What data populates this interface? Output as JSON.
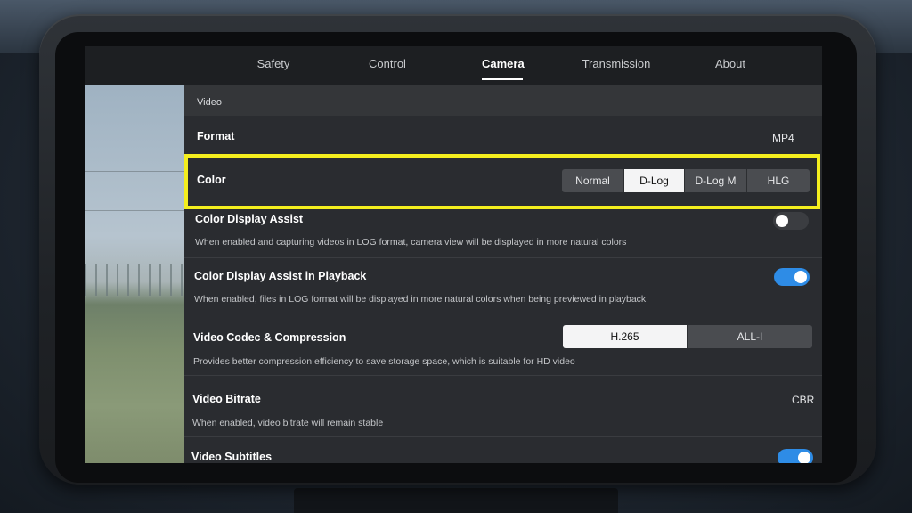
{
  "tabs": [
    {
      "label": "Safety"
    },
    {
      "label": "Control"
    },
    {
      "label": "Camera"
    },
    {
      "label": "Transmission"
    },
    {
      "label": "About"
    }
  ],
  "active_tab": "Camera",
  "section": {
    "title": "Video"
  },
  "format": {
    "label": "Format",
    "value": "MP4"
  },
  "color": {
    "label": "Color",
    "options": [
      "Normal",
      "D-Log",
      "D-Log M",
      "HLG"
    ],
    "selected": "D-Log",
    "highlight_color": "#f4ee1e"
  },
  "color_display_assist": {
    "label": "Color Display Assist",
    "description": "When enabled and capturing videos in LOG format, camera view will be displayed in more natural colors",
    "enabled": false
  },
  "color_display_assist_playback": {
    "label": "Color Display Assist in Playback",
    "description": "When enabled, files in LOG format will be displayed in more natural colors when being previewed in playback",
    "enabled": true
  },
  "video_codec": {
    "label": "Video Codec & Compression",
    "description": "Provides better compression efficiency to save storage space, which is suitable for HD video",
    "options": [
      "H.265",
      "ALL-I"
    ],
    "selected": "H.265"
  },
  "video_bitrate": {
    "label": "Video Bitrate",
    "description": "When enabled, video bitrate will remain stable",
    "value": "CBR"
  },
  "video_subtitles": {
    "label": "Video Subtitles",
    "enabled": true
  },
  "colors": {
    "toggle_on": "#2e8ce6",
    "toggle_off": "#3b3d41",
    "accent_highlight": "#f4ee1e"
  }
}
